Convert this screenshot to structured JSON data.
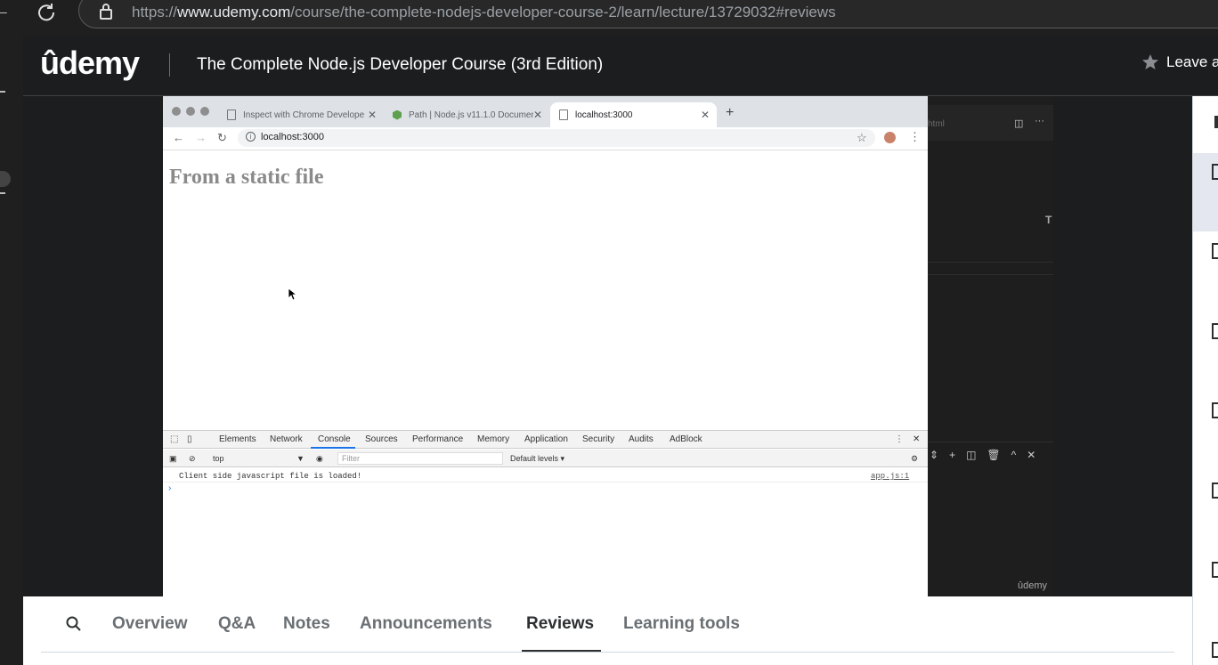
{
  "outer_browser": {
    "url_prefix": "https://",
    "url_domain": "www.udemy.com",
    "url_path": "/course/the-complete-nodejs-developer-course-2/learn/lecture/13729032#reviews"
  },
  "header": {
    "logo": "ûdemy",
    "course_title": "The Complete Node.js Developer Course (3rd Edition)",
    "leave_rating": "Leave a"
  },
  "inner_browser": {
    "tabs": [
      {
        "label": "Inspect with Chrome Develope",
        "icon": "page-icon"
      },
      {
        "label": "Path | Node.js v11.1.0 Documen",
        "icon": "nodejs-icon"
      },
      {
        "label": "localhost:3000",
        "icon": "page-icon",
        "active": true
      }
    ],
    "url": "localhost:3000",
    "page_heading": "From a static file"
  },
  "devtools": {
    "tabs": [
      "Elements",
      "Network",
      "Console",
      "Sources",
      "Performance",
      "Memory",
      "Application",
      "Security",
      "Audits",
      "AdBlock"
    ],
    "active_tab": "Console",
    "context": "top",
    "filter_placeholder": "Filter",
    "levels": "Default levels ▾",
    "console_message": "Client side javascript file is loaded!",
    "console_source": "app.js:1"
  },
  "editor": {
    "tab_fragment": "html",
    "watermark": "ûdemy"
  },
  "bottom_nav": {
    "tabs": [
      "Overview",
      "Q&A",
      "Notes",
      "Announcements",
      "Reviews",
      "Learning tools"
    ],
    "active": "Reviews"
  },
  "colors": {
    "udemy_header_bg": "#1c1d1f",
    "devtools_active": "#1a73e8"
  }
}
